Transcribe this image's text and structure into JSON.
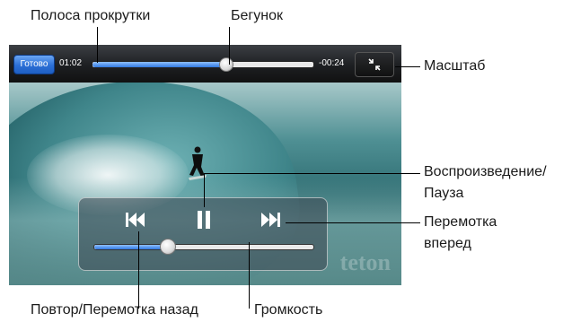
{
  "callouts": {
    "scrub_bar": "Полоса прокрутки",
    "playhead": "Бегунок",
    "scale": "Масштаб",
    "play_pause_line1": "Воспроизведение/",
    "play_pause_line2": "Пауза",
    "fast_forward_line1": "Перемотка",
    "fast_forward_line2": "вперед",
    "rewind": "Повтор/Перемотка назад",
    "volume": "Громкость"
  },
  "player": {
    "done_label": "Готово",
    "elapsed": "01:02",
    "remaining": "-00:24",
    "progress_fraction": 0.6,
    "volume_fraction": 0.33,
    "watermark": "teton",
    "accent_color": "#2f78e0"
  },
  "icons": {
    "rewind": "skip-back-icon",
    "play_pause": "pause-icon",
    "fast_forward": "skip-forward-icon",
    "scale": "collapse-icon"
  }
}
